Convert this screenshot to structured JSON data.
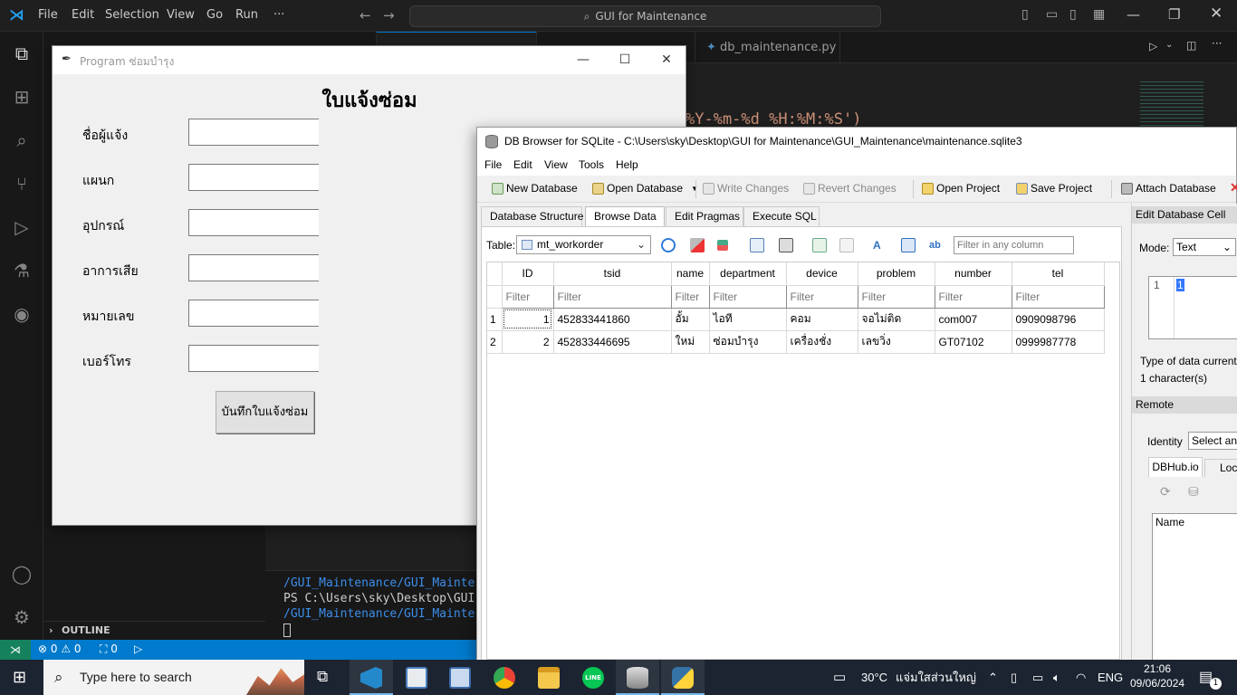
{
  "vscode": {
    "menu": [
      "File",
      "Edit",
      "Selection",
      "View",
      "Go",
      "Run",
      "···"
    ],
    "command_center": "GUI for Maintenance",
    "tab_active": "db_maintenance.py",
    "code_fragment": "%Y-%m-%d %H:%M:%S')",
    "terminal": [
      "/GUI_Maintenance/GUI_Mainter",
      "PS C:\\Users\\sky\\Desktop\\GUI",
      "/GUI_Maintenance/GUI_Mainter"
    ],
    "outline": "OUTLINE",
    "status_problems": "⊗ 0 ⚠ 0",
    "status_ports": "⛶ 0"
  },
  "tk_app": {
    "title": "Program ซ่อมบำรุง",
    "heading": "ใบแจ้งซ่อม",
    "fields": [
      "ชื่อผู้แจ้ง",
      "แผนก",
      "อุปกรณ์",
      "อาการเสีย",
      "หมายเลข",
      "เบอร์โทร"
    ],
    "save_button": "บันทึกใบแจ้งซ่อม"
  },
  "db_browser": {
    "title": "DB Browser for SQLite - C:\\Users\\sky\\Desktop\\GUI for Maintenance\\GUI_Maintenance\\maintenance.sqlite3",
    "menu": [
      "File",
      "Edit",
      "View",
      "Tools",
      "Help"
    ],
    "toolbar": {
      "new_db": "New Database",
      "open_db": "Open Database",
      "write": "Write Changes",
      "revert": "Revert Changes",
      "open_project": "Open Project",
      "save_project": "Save Project",
      "attach": "Attach Database"
    },
    "tabs": [
      "Database Structure",
      "Browse Data",
      "Edit Pragmas",
      "Execute SQL"
    ],
    "table_label": "Table:",
    "table_name": "mt_workorder",
    "filter_placeholder": "Filter in any column",
    "columns": [
      "ID",
      "tsid",
      "name",
      "department",
      "device",
      "problem",
      "number",
      "tel"
    ],
    "filter_text": "Filter",
    "rows": [
      [
        "1",
        "1",
        "452833441860",
        "อั้ม",
        "ไอที",
        "คอม",
        "จอไม่ติด",
        "com007",
        "0909098796"
      ],
      [
        "2",
        "2",
        "452833446695",
        "ใหม่",
        "ซ่อมบำรุง",
        "เครื่องชั่ง",
        "เลขวิ่ง",
        "GT07102",
        "0999987778"
      ]
    ],
    "right_panel": {
      "edit_cell_title": "Edit Database Cell",
      "mode_label": "Mode:",
      "mode_value": "Text",
      "cell_line": "1",
      "cell_value": "1",
      "type_info": "Type of data currently",
      "char_info": "1 character(s)",
      "remote_title": "Remote",
      "identity_label": "Identity",
      "identity_value": "Select an id",
      "tab_dbhub": "DBHub.io",
      "tab_local": "Loca",
      "name_header": "Name"
    }
  },
  "taskbar": {
    "search_placeholder": "Type here to search",
    "weather": "30°C",
    "weather_desc": "แจ่มใสส่วนใหญ่",
    "lang": "ENG",
    "time": "21:06",
    "date": "09/06/2024",
    "notifications": "1"
  }
}
